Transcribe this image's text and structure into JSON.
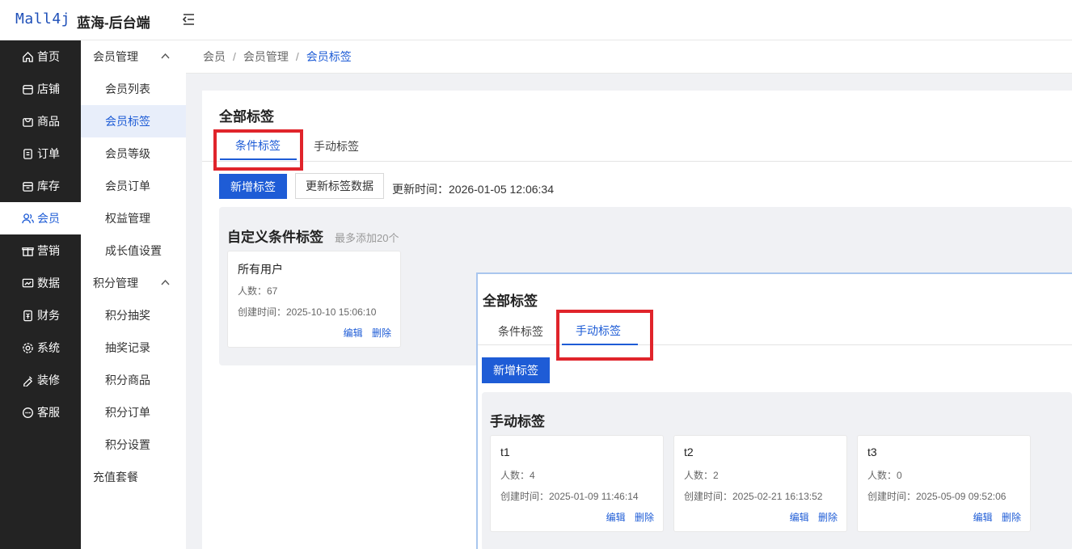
{
  "header": {
    "logo": "Mall4j",
    "shop_name": "蓝海-后台端"
  },
  "nav_primary": [
    {
      "label": "首页",
      "icon": "home-icon"
    },
    {
      "label": "店铺",
      "icon": "shop-icon"
    },
    {
      "label": "商品",
      "icon": "bag-icon"
    },
    {
      "label": "订单",
      "icon": "order-icon"
    },
    {
      "label": "库存",
      "icon": "box-icon"
    },
    {
      "label": "会员",
      "icon": "user-icon",
      "active": true
    },
    {
      "label": "营销",
      "icon": "gift-icon"
    },
    {
      "label": "数据",
      "icon": "chart-icon"
    },
    {
      "label": "财务",
      "icon": "money-icon"
    },
    {
      "label": "系统",
      "icon": "gear-icon"
    },
    {
      "label": "装修",
      "icon": "brush-icon"
    },
    {
      "label": "客服",
      "icon": "chat-icon"
    }
  ],
  "nav_secondary": {
    "group1": "会员管理",
    "group1_items": [
      "会员列表",
      "会员标签",
      "会员等级",
      "会员订单",
      "权益管理",
      "成长值设置"
    ],
    "group2": "积分管理",
    "group2_items": [
      "积分抽奖",
      "抽奖记录",
      "积分商品",
      "积分订单",
      "积分设置"
    ],
    "group3": "充值套餐"
  },
  "breadcrumb": {
    "item1": "会员",
    "item2": "会员管理",
    "current": "会员标签",
    "sep": "/"
  },
  "main": {
    "title": "全部标签",
    "tab_condition": "条件标签",
    "tab_manual": "手动标签",
    "btn_add": "新增标签",
    "btn_refresh": "更新标签数据",
    "update_time": "更新时间：2026-01-05 12:06:34",
    "section_title": "自定义条件标签",
    "section_hint": "最多添加20个",
    "cards": [
      {
        "name": "所有用户",
        "count": "人数：67",
        "created": "创建时间：2025-10-10 15:06:10",
        "edit": "编辑",
        "delete": "删除"
      }
    ]
  },
  "overlay": {
    "title": "全部标签",
    "tab_condition": "条件标签",
    "tab_manual": "手动标签",
    "btn_add": "新增标签",
    "section_title": "手动标签",
    "cards": [
      {
        "name": "t1",
        "count": "人数：4",
        "created": "创建时间：2025-01-09 11:46:14",
        "edit": "编辑",
        "delete": "删除"
      },
      {
        "name": "t2",
        "count": "人数：2",
        "created": "创建时间：2025-02-21 16:13:52",
        "edit": "编辑",
        "delete": "删除"
      },
      {
        "name": "t3",
        "count": "人数：0",
        "created": "创建时间：2025-05-09 09:52:06",
        "edit": "编辑",
        "delete": "删除"
      }
    ]
  },
  "colors": {
    "brand": "#1e5cd6",
    "highlight": "#e0242b",
    "sidebar": "#232323"
  }
}
